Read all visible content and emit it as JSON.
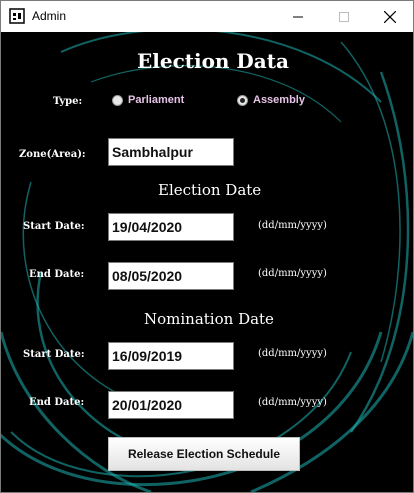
{
  "window": {
    "title": "Admin"
  },
  "form": {
    "heading": "Election Data",
    "type_label": "Type:",
    "type_options": [
      {
        "label": "Parliament",
        "checked": false
      },
      {
        "label": "Assembly",
        "checked": true
      }
    ],
    "zone_label": "Zone(Area):",
    "zone_value": "Sambhalpur",
    "election_heading": "Election Date",
    "election_start_label": "Start Date:",
    "election_start_value": "19/04/2020",
    "election_end_label": "End Date:",
    "election_end_value": "08/05/2020",
    "nomination_heading": "Nomination Date",
    "nomination_start_label": "Start Date:",
    "nomination_start_value": "16/09/2019",
    "nomination_end_label": "End Date:",
    "nomination_end_value": "20/01/2020",
    "date_format": "(dd/mm/yyyy)",
    "release_button": "Release Election Schedule"
  },
  "colors": {
    "background": "#000000",
    "swirl": "#1fb3b3",
    "radio_text": "#e6c3e6"
  }
}
